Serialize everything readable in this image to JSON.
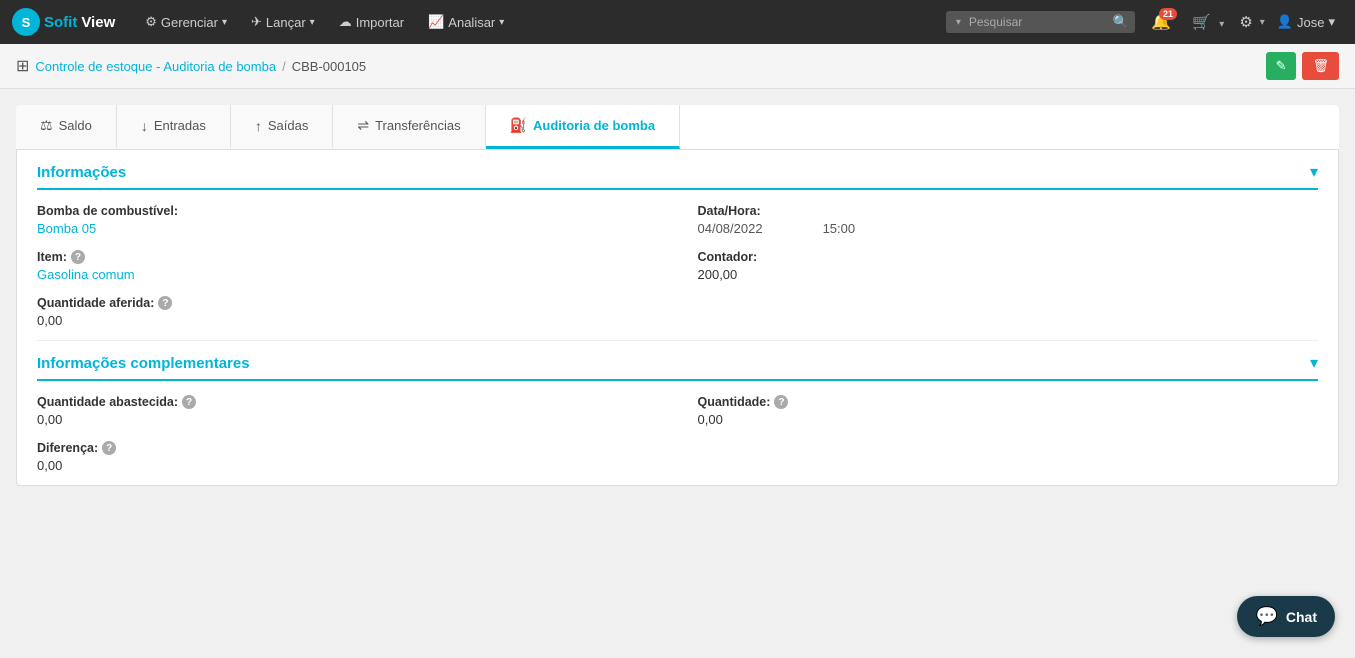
{
  "brand": {
    "sofit": "Sofit",
    "view": "View"
  },
  "navbar": {
    "gerenciar": "Gerenciar",
    "lancar": "Lançar",
    "importar": "Importar",
    "analisar": "Analisar",
    "search_placeholder": "Pesquisar",
    "notification_badge": "21",
    "user": "Jose"
  },
  "breadcrumb": {
    "parent": "Controle de estoque - Auditoria de bomba",
    "separator": "/",
    "current": "CBB-000105"
  },
  "actions": {
    "edit_label": "✎",
    "delete_label": "🗑"
  },
  "tabs": [
    {
      "id": "saldo",
      "icon": "⚖",
      "label": "Saldo",
      "active": false
    },
    {
      "id": "entradas",
      "icon": "↓",
      "label": "Entradas",
      "active": false
    },
    {
      "id": "saidas",
      "icon": "↑",
      "label": "Saídas",
      "active": false
    },
    {
      "id": "transferencias",
      "icon": "⇌",
      "label": "Transferências",
      "active": false
    },
    {
      "id": "auditoria",
      "icon": "⛽",
      "label": "Auditoria de bomba",
      "active": true
    }
  ],
  "informacoes": {
    "title": "Informações",
    "bomba_label": "Bomba de combustível:",
    "bomba_value": "Bomba 05",
    "data_label": "Data/Hora:",
    "data_value": "04/08/2022",
    "hora_value": "15:00",
    "item_label": "Item:",
    "item_value": "Gasolina comum",
    "contador_label": "Contador:",
    "contador_value": "200,00",
    "quantidade_label": "Quantidade aferida:",
    "quantidade_value": "0,00"
  },
  "informacoes_complementares": {
    "title": "Informações complementares",
    "abastecida_label": "Quantidade abastecida:",
    "abastecida_value": "0,00",
    "quantidade_label": "Quantidade:",
    "quantidade_value": "0,00",
    "diferenca_label": "Diferença:",
    "diferenca_value": "0,00"
  },
  "chat": {
    "label": "Chat"
  },
  "colors": {
    "accent": "#00b5d8",
    "danger": "#e74c3c",
    "success": "#27ae60"
  }
}
